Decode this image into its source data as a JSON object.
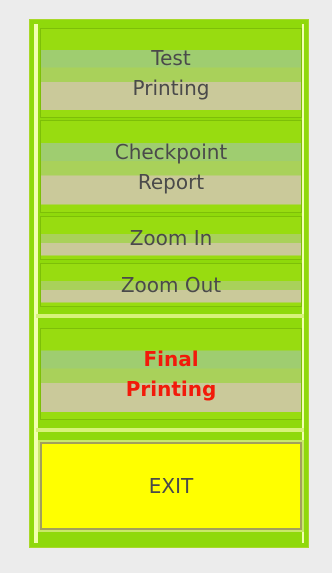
{
  "menu": {
    "test_printing": {
      "line1": "Test",
      "line2": "Printing"
    },
    "checkpoint_report": {
      "line1": "Checkpoint",
      "line2": "Report"
    },
    "zoom_in": "Zoom In",
    "zoom_out": "Zoom Out",
    "final_printing": {
      "line1": "Final",
      "line2": "Printing"
    },
    "exit": "EXIT"
  },
  "colors": {
    "panel": "#8fd90b",
    "final_text": "#f21a0a",
    "exit_background": "#ffff00"
  }
}
